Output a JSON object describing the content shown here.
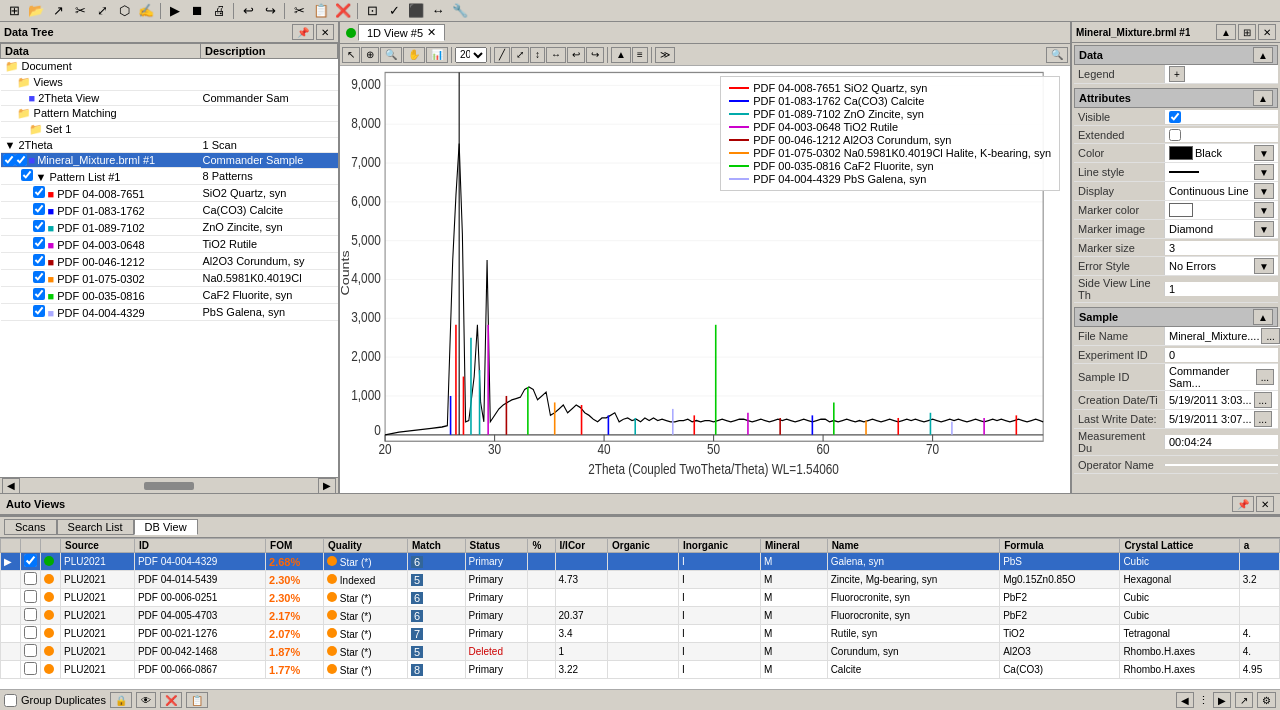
{
  "app": {
    "title": "Mineral_Mixture.brml #1",
    "toolbars": {
      "icons1": [
        "⊞",
        "🔍",
        "↗",
        "✂",
        "⤢",
        "⬡",
        "✍",
        "▷",
        "⏹",
        "🖨",
        "↩",
        "↪",
        "✂",
        "📋",
        "❌",
        "⊡",
        "✓",
        "⬛",
        "↔",
        "🔧"
      ],
      "icons2": [
        "⟳",
        "📐",
        "📊",
        "📈",
        "🔎",
        "🔍",
        "↕",
        "📉"
      ]
    }
  },
  "data_tree": {
    "title": "Data Tree",
    "columns": [
      "Data",
      "Description"
    ],
    "items": {
      "document": "Document",
      "views": "Views",
      "view_2theta": {
        "name": "2Theta View",
        "desc": "Commander Sam"
      },
      "pattern_matching": "Pattern Matching",
      "set1": "Set 1",
      "two_theta": {
        "name": "2Theta",
        "desc": "1 Scan"
      },
      "mineral_mixture": {
        "name": "Mineral_Mixture.brml #1",
        "desc": "Commander Sample"
      },
      "pattern_list": {
        "name": "Pattern List #1",
        "desc": "8 Patterns"
      },
      "patterns": [
        {
          "id": "PDF 04-008-7651",
          "name": "SiO2 Quartz, syn"
        },
        {
          "id": "PDF 01-083-1762",
          "name": "Ca(CO3) Calcite"
        },
        {
          "id": "PDF 01-089-7102",
          "name": "ZnO Zincite, syn"
        },
        {
          "id": "PDF 04-003-0648",
          "name": "TiO2 Rutile"
        },
        {
          "id": "PDF 00-046-1212",
          "name": "Al2O3 Corundum, sy"
        },
        {
          "id": "PDF 01-075-0302",
          "name": "Na0.5981K0.4019Cl"
        },
        {
          "id": "PDF 00-035-0816",
          "name": "CaF2 Fluorite, syn"
        },
        {
          "id": "PDF 04-004-4329",
          "name": "PbS Galena, syn"
        }
      ]
    }
  },
  "chart": {
    "tab_label": "1D View #5",
    "x_axis_label": "2Theta (Coupled TwoTheta/Theta) WL=1.54060",
    "y_axis_label": "Counts",
    "zoom": "20",
    "y_values": [
      "9,000",
      "8,000",
      "7,000",
      "6,000",
      "5,000",
      "4,000",
      "3,000",
      "2,000",
      "1,000",
      "0"
    ],
    "x_values": [
      "20",
      "30",
      "40",
      "50",
      "60",
      "70"
    ],
    "legend": [
      {
        "color": "#ff0000",
        "label": "PDF 04-008-7651 SiO2 Quartz, syn"
      },
      {
        "color": "#0000ff",
        "label": "PDF 01-083-1762 Ca(CO3) Calcite"
      },
      {
        "color": "#00aaaa",
        "label": "PDF 01-089-7102 ZnO Zincite, syn"
      },
      {
        "color": "#cc00cc",
        "label": "PDF 04-003-0648 TiO2 Rutile"
      },
      {
        "color": "#aa0000",
        "label": "PDF 00-046-1212 Al2O3 Corundum, syn"
      },
      {
        "color": "#ff8800",
        "label": "PDF 01-075-0302 Na0.5981K0.4019Cl Halite, K-bearing, syn"
      },
      {
        "color": "#00cc00",
        "label": "PDF 00-035-0816 CaF2 Fluorite, syn"
      },
      {
        "color": "#aaaaff",
        "label": "PDF 04-004-4329 PbS Galena, syn"
      }
    ]
  },
  "right_panel": {
    "title": "Mineral_Mixture.brml #1",
    "sections": {
      "data": {
        "label": "Data",
        "legend": "Legend"
      },
      "attributes": {
        "label": "Attributes",
        "visible_label": "Visible",
        "extended_label": "Extended",
        "color_label": "Color",
        "color_value": "Black",
        "line_style_label": "Line style",
        "display_label": "Display",
        "display_value": "Continuous Line",
        "marker_color_label": "Marker color",
        "marker_image_label": "Marker image",
        "marker_image_value": "Diamond",
        "marker_size_label": "Marker size",
        "marker_size_value": "3",
        "error_style_label": "Error Style",
        "error_style_value": "No Errors",
        "side_view_label": "Side View Line Th",
        "side_view_value": "1"
      },
      "sample": {
        "label": "Sample",
        "file_name_label": "File Name",
        "file_name_value": "Mineral_Mixture....",
        "experiment_id_label": "Experiment ID",
        "experiment_id_value": "0",
        "sample_id_label": "Sample ID",
        "sample_id_value": "Commander Sam...",
        "creation_date_label": "Creation Date/Ti",
        "creation_date_value": "5/19/2011 3:03...",
        "last_write_label": "Last Write Date:",
        "last_write_value": "5/19/2011 3:07...",
        "measurement_label": "Measurement Du",
        "measurement_value": "00:04:24",
        "operator_label": "Operator Name"
      }
    }
  },
  "bottom": {
    "auto_views_label": "Auto Views",
    "tabs": [
      "Scans",
      "Search List",
      "DB View"
    ],
    "active_tab": "DB View",
    "columns": [
      "",
      "",
      "",
      "Source",
      "ID",
      "FOM",
      "Quality",
      "Match",
      "Status",
      "%",
      "I/ICor",
      "Organic",
      "Inorganic",
      "Mineral",
      "Name",
      "Formula",
      "Crystal Lattice",
      "a"
    ],
    "rows": [
      {
        "sel": true,
        "check": true,
        "src": "PLU2021",
        "id": "PDF 04-004-4329",
        "fom": "2.68%",
        "quality": "Star (*)",
        "match": "6",
        "status": "Primary",
        "pct": "",
        "iicor": "",
        "organic": "",
        "inorganic": "I",
        "mineral": "M",
        "name": "Galena, syn",
        "formula": "PbS",
        "crystal": "Cubic",
        "a": ""
      },
      {
        "sel": false,
        "check": false,
        "src": "PLU2021",
        "id": "PDF 04-014-5439",
        "fom": "2.30%",
        "quality": "Indexed",
        "match": "5",
        "status": "Primary",
        "pct": "",
        "iicor": "4.73",
        "organic": "",
        "inorganic": "I",
        "mineral": "M",
        "name": "Zincite, Mg-bearing, syn",
        "formula": "Mg0.15Zn0.85O",
        "crystal": "Hexagonal",
        "a": "3.2"
      },
      {
        "sel": false,
        "check": false,
        "src": "PLU2021",
        "id": "PDF 00-006-0251",
        "fom": "2.30%",
        "quality": "Star (*)",
        "match": "6",
        "status": "Primary",
        "pct": "",
        "iicor": "",
        "organic": "",
        "inorganic": "I",
        "mineral": "M",
        "name": "Fluorocronite, syn",
        "formula": "PbF2",
        "crystal": "Cubic",
        "a": ""
      },
      {
        "sel": false,
        "check": false,
        "src": "PLU2021",
        "id": "PDF 04-005-4703",
        "fom": "2.17%",
        "quality": "Star (*)",
        "match": "6",
        "status": "Primary",
        "pct": "",
        "iicor": "20.37",
        "organic": "",
        "inorganic": "I",
        "mineral": "M",
        "name": "Fluorocronite, syn",
        "formula": "PbF2",
        "crystal": "Cubic",
        "a": ""
      },
      {
        "sel": false,
        "check": false,
        "src": "PLU2021",
        "id": "PDF 00-021-1276",
        "fom": "2.07%",
        "quality": "Star (*)",
        "match": "7",
        "status": "Primary",
        "pct": "",
        "iicor": "3.4",
        "organic": "",
        "inorganic": "I",
        "mineral": "M",
        "name": "Rutile, syn",
        "formula": "TiO2",
        "crystal": "Tetragonal",
        "a": "4."
      },
      {
        "sel": false,
        "check": false,
        "src": "PLU2021",
        "id": "PDF 00-042-1468",
        "fom": "1.87%",
        "quality": "Star (*)",
        "match": "5",
        "status": "Deleted",
        "pct": "",
        "iicor": "1",
        "organic": "",
        "inorganic": "I",
        "mineral": "M",
        "name": "Corundum, syn",
        "formula": "Al2O3",
        "crystal": "Rhombo.H.axes",
        "a": "4."
      },
      {
        "sel": false,
        "check": false,
        "src": "PLU2021",
        "id": "PDF 00-066-0867",
        "fom": "1.77%",
        "quality": "Star (*)",
        "match": "8",
        "status": "Primary",
        "pct": "",
        "iicor": "3.22",
        "organic": "",
        "inorganic": "I",
        "mineral": "M",
        "name": "Calcite",
        "formula": "Ca(CO3)",
        "crystal": "Rhombo.H.axes",
        "a": "4.95"
      }
    ],
    "footer": {
      "group_duplicates": "Group Duplicates"
    }
  }
}
